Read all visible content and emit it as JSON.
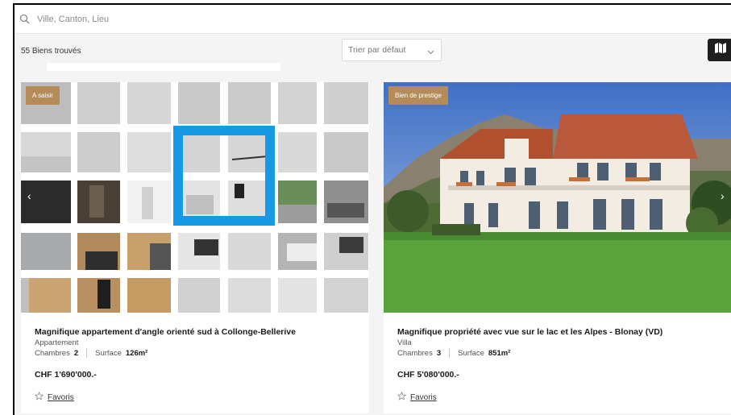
{
  "search": {
    "placeholder": "Ville, Canton, Lieu",
    "icon": "search-icon"
  },
  "toolbar": {
    "results_count": "55 Biens trouvés",
    "sort_selected": "Trier par défaut",
    "map_icon": "map-icon"
  },
  "listings": [
    {
      "tag": "A saisir",
      "title": "Magnifique appartement d'angle orienté sud à Collonge-Bellerive",
      "type": "Appartement",
      "rooms_label": "Chambres",
      "rooms": "2",
      "surface_label": "Surface",
      "surface": "126m²",
      "price": "CHF 1'690'000.-",
      "favorite_label": "Favoris"
    },
    {
      "tag": "Bien de prestige",
      "title": "Magnifique propriété avec vue sur le lac et les Alpes - Blonay (VD)",
      "type": "Villa",
      "rooms_label": "Chambres",
      "rooms": "3",
      "surface_label": "Surface",
      "surface": "851m²",
      "price": "CHF 5'080'000.-",
      "favorite_label": "Favoris"
    }
  ],
  "colors": {
    "tag": "#b58b58",
    "focus": "#1799e6",
    "map_button": "#1f1f1f"
  }
}
